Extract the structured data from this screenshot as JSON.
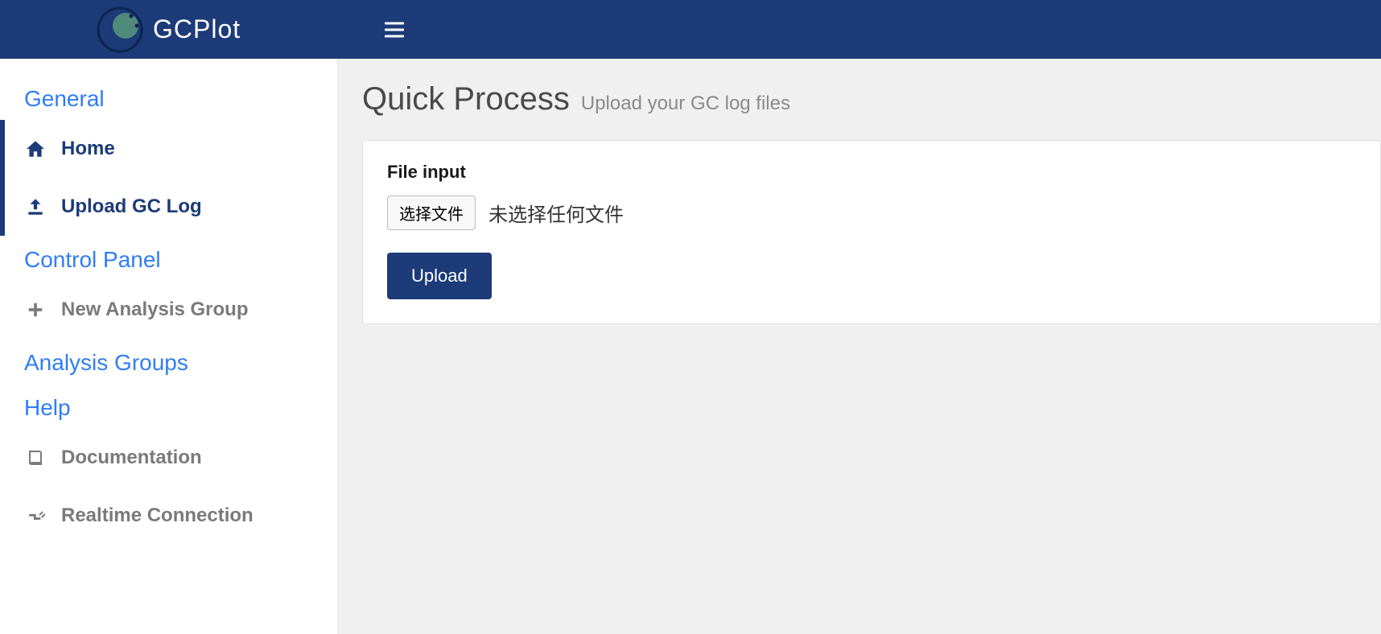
{
  "header": {
    "brand": "GCPlot"
  },
  "sidebar": {
    "sections": [
      {
        "heading": "General"
      },
      {
        "heading": "Control Panel"
      },
      {
        "heading": "Analysis Groups"
      },
      {
        "heading": "Help"
      }
    ],
    "home_label": "Home",
    "upload_label": "Upload GC Log",
    "new_group_label": "New Analysis Group",
    "documentation_label": "Documentation",
    "realtime_label": "Realtime Connection"
  },
  "content": {
    "title": "Quick Process",
    "subtitle": "Upload your GC log files",
    "file_input_label": "File input",
    "choose_file_label": "选择文件",
    "no_file_text": "未选择任何文件",
    "upload_button_label": "Upload"
  }
}
